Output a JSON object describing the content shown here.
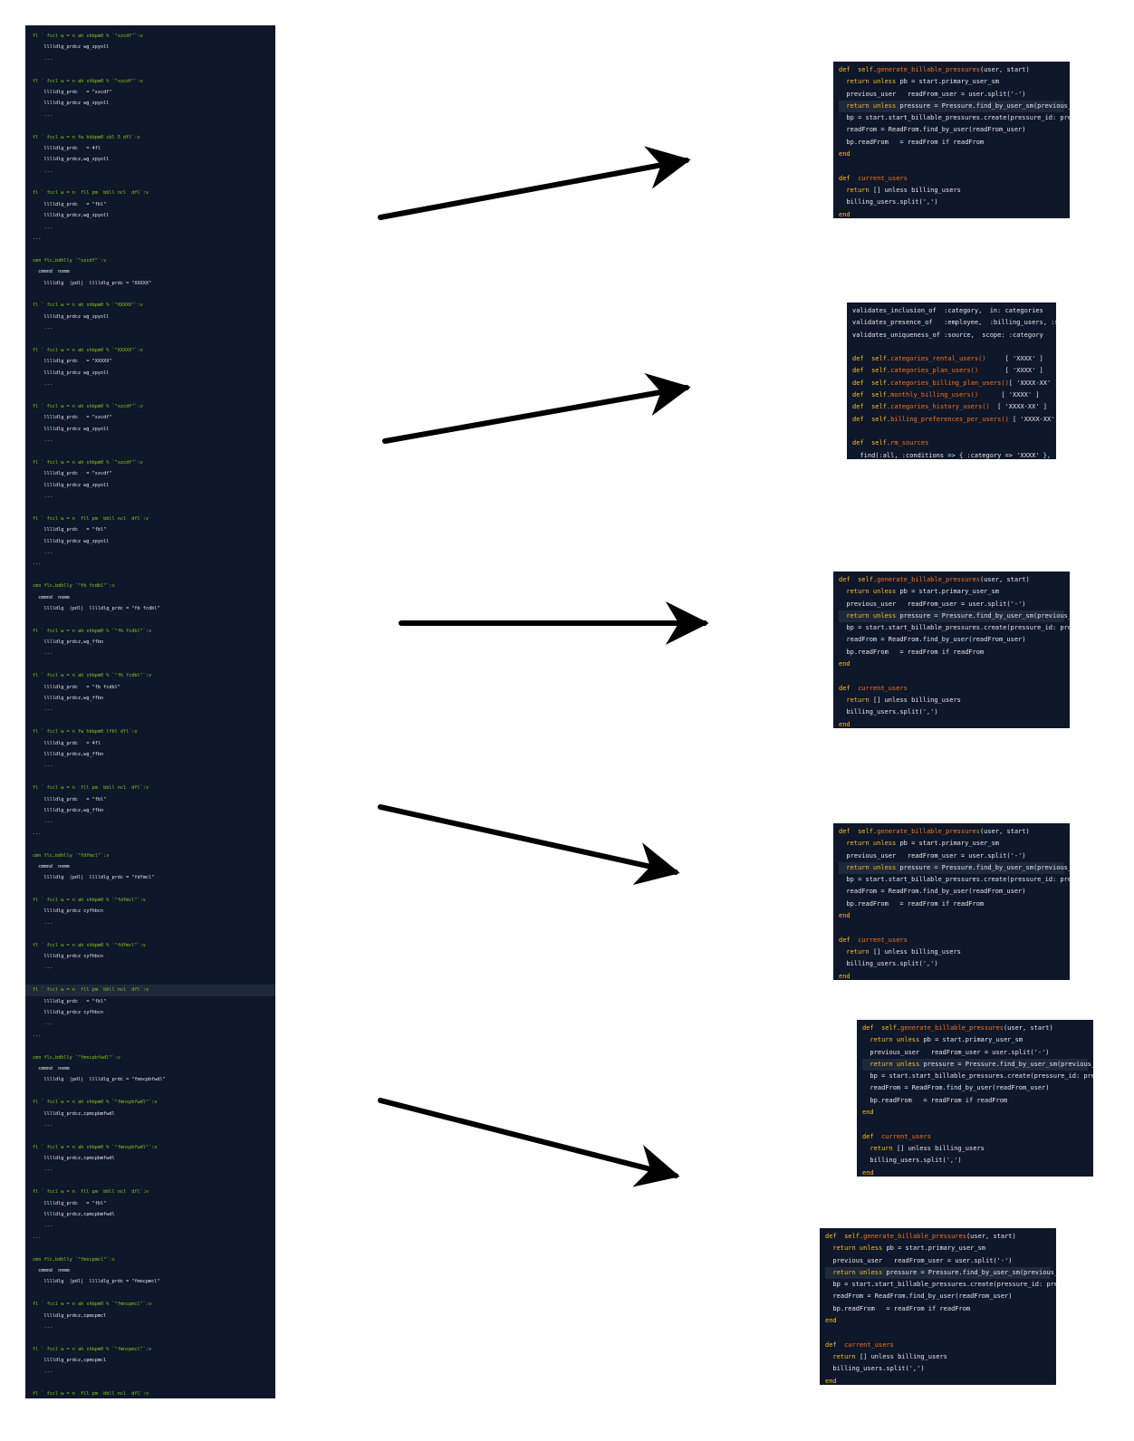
{
  "left_panel": {
    "lines": [
      {
        "t": "fl ` fccl w = n ah shbpm0 % `\"xzcdf\"`:v",
        "cls": "c-str"
      },
      {
        "t": "    lllldlg_prdcz wg_zpyoll",
        "cls": "c-def"
      },
      {
        "t": "    ...",
        "cls": "c-key"
      },
      {
        "t": "",
        "cls": "c-def"
      },
      {
        "t": "fl ` fccl w = n ah shbpm0 % `\"xzcdf\"`:v",
        "cls": "c-str"
      },
      {
        "t": "    lllldlg_prdc   = \"xzcdf\"",
        "cls": "c-def"
      },
      {
        "t": "    lllldlg_prdcz wg_zpyoll",
        "cls": "c-def"
      },
      {
        "t": "    ...",
        "cls": "c-key"
      },
      {
        "t": "",
        "cls": "c-def"
      },
      {
        "t": "fl ` fccl w = n fw hbbpm0 cbl 5 dfl`:v",
        "cls": "c-str"
      },
      {
        "t": "    lllldlg_prdc   = 4fl",
        "cls": "c-def"
      },
      {
        "t": "    lllldlg_prdcz,wg_zpyoll",
        "cls": "c-def"
      },
      {
        "t": "    ...",
        "cls": "c-key"
      },
      {
        "t": "",
        "cls": "c-def"
      },
      {
        "t": "fl ` fccl w = n  fll pm  bbll ncl  dfl`:v",
        "cls": "c-str"
      },
      {
        "t": "    lllldlg_prdc   = \"fbl\"",
        "cls": "c-def"
      },
      {
        "t": "    lllldlg_prdcz,wg_zpyoll",
        "cls": "c-def"
      },
      {
        "t": "    ...",
        "cls": "c-key"
      },
      {
        "t": "...",
        "cls": "c-key"
      },
      {
        "t": "",
        "cls": "c-def"
      },
      {
        "t": "cmn flc,bdhlly `\"xzcdf\"`:v",
        "cls": "c-str"
      },
      {
        "t": "  cmmnd  nnmm",
        "cls": "c-def"
      },
      {
        "t": "    lllldlg  |pdl|  lllldlg_prdc = \"XXXXX\"",
        "cls": "c-def"
      },
      {
        "t": "",
        "cls": "c-def"
      },
      {
        "t": "fl ` fccl w = n ah shbpm0 % `\"XXXXX\"`:v",
        "cls": "c-str"
      },
      {
        "t": "    lllldlg_prdcz wg_zpyoll",
        "cls": "c-def"
      },
      {
        "t": "    ...",
        "cls": "c-key"
      },
      {
        "t": "",
        "cls": "c-def"
      },
      {
        "t": "fl ` fccl w = n ah shbpm0 % `\"XXXXX\"`:v",
        "cls": "c-str"
      },
      {
        "t": "    lllldlg_prdc   = \"XXXXX\"",
        "cls": "c-def"
      },
      {
        "t": "    lllldlg_prdcz wg_zpyoll",
        "cls": "c-def"
      },
      {
        "t": "    ...",
        "cls": "c-key"
      },
      {
        "t": "",
        "cls": "c-def"
      },
      {
        "t": "fl ` fccl w = n ah shbpm0 % `\"xzcdf\"`:v",
        "cls": "c-str"
      },
      {
        "t": "    lllldlg_prdc   = \"xzcdf\"",
        "cls": "c-def"
      },
      {
        "t": "    lllldlg_prdcz wg_zpyoll",
        "cls": "c-def"
      },
      {
        "t": "    ...",
        "cls": "c-key"
      },
      {
        "t": "",
        "cls": "c-def"
      },
      {
        "t": "fl ` fccl w = n ah shbpm0 % `\"xzcdf\"`:v",
        "cls": "c-str"
      },
      {
        "t": "    lllldlg_prdc   = \"xzcdf\"",
        "cls": "c-def"
      },
      {
        "t": "    lllldlg_prdcz wg_zpyoll",
        "cls": "c-def"
      },
      {
        "t": "    ...",
        "cls": "c-key"
      },
      {
        "t": "",
        "cls": "c-def"
      },
      {
        "t": "fl ` fccl w = n  fll pm  bbll ncl  dfl`:v",
        "cls": "c-str"
      },
      {
        "t": "    lllldlg_prdc   = \"fbl\"",
        "cls": "c-def"
      },
      {
        "t": "    lllldlg_prdcz wg_zpyoll",
        "cls": "c-def"
      },
      {
        "t": "    ...",
        "cls": "c-key"
      },
      {
        "t": "...",
        "cls": "c-key"
      },
      {
        "t": "",
        "cls": "c-def"
      },
      {
        "t": "cmn flc,bdhlly `\"fb fcdbl\"`:v",
        "cls": "c-str"
      },
      {
        "t": "  cmmnd  nnmm",
        "cls": "c-def"
      },
      {
        "t": "    lllldlg  |pdl|  lllldlg_prdc = \"fb fcdbl\"",
        "cls": "c-def"
      },
      {
        "t": "",
        "cls": "c-def"
      },
      {
        "t": "fl ` fccl w = n ah shbpm0 % `\"fb fcdbl\"`:v",
        "cls": "c-str"
      },
      {
        "t": "    lllldlg_prdcz,wg_ffbn",
        "cls": "c-def"
      },
      {
        "t": "    ...",
        "cls": "c-key"
      },
      {
        "t": "",
        "cls": "c-def"
      },
      {
        "t": "fl ` fccl w = n ah shbpm0 % `\"fb fcdbl\"`:v",
        "cls": "c-str"
      },
      {
        "t": "    lllldlg_prdc   = \"fb fcdbl\"",
        "cls": "c-def"
      },
      {
        "t": "    lllldlg_prdcz,wg_ffbn",
        "cls": "c-def"
      },
      {
        "t": "    ...",
        "cls": "c-key"
      },
      {
        "t": "",
        "cls": "c-def"
      },
      {
        "t": "fl ` fccl w = n fw hbbpm0 lfbl dfl`:v",
        "cls": "c-str"
      },
      {
        "t": "    lllldlg_prdc   = 4fl",
        "cls": "c-def"
      },
      {
        "t": "    lllldlg_prdcz,wg_ffbn",
        "cls": "c-def"
      },
      {
        "t": "    ...",
        "cls": "c-key"
      },
      {
        "t": "",
        "cls": "c-def"
      },
      {
        "t": "fl ` fccl w = n  fll pm  bbll ncl  dfl`:v",
        "cls": "c-str"
      },
      {
        "t": "    lllldlg_prdc   = \"fbl\"",
        "cls": "c-def"
      },
      {
        "t": "    lllldlg_prdcz,wg_ffbn",
        "cls": "c-def"
      },
      {
        "t": "    ...",
        "cls": "c-key"
      },
      {
        "t": "...",
        "cls": "c-key"
      },
      {
        "t": "",
        "cls": "c-def"
      },
      {
        "t": "cmn flc,bdhlly `\"fdfmcl\"`:v",
        "cls": "c-str"
      },
      {
        "t": "  cmmnd  nnmm",
        "cls": "c-def"
      },
      {
        "t": "    lllldlg  |pdl|  lllldlg_prdc = \"fdfmcl\"",
        "cls": "c-def"
      },
      {
        "t": "",
        "cls": "c-def"
      },
      {
        "t": "fl ` fccl w = n ah shbpm0 % `\"fdfmcl\"`:v",
        "cls": "c-str"
      },
      {
        "t": "    lllldlg_prdcz cyfhbcn",
        "cls": "c-def"
      },
      {
        "t": "    ...",
        "cls": "c-key"
      },
      {
        "t": "",
        "cls": "c-def"
      },
      {
        "t": "fl ` fccl w = n ah shbpm0 % `\"fdfmcl\"`:v",
        "cls": "c-str"
      },
      {
        "t": "    lllldlg_prdcz cyfhbcn",
        "cls": "c-def"
      },
      {
        "t": "    ...",
        "cls": "c-key"
      },
      {
        "t": "",
        "cls": "c-def"
      },
      {
        "t": "fl ` fccl w = n  fll pm  bbll ncl  dfl`:v",
        "cls": "c-str",
        "hl": true
      },
      {
        "t": "    lllldlg_prdc   = \"fbl\"",
        "cls": "c-def"
      },
      {
        "t": "    lllldlg_prdcz cyfhbcn",
        "cls": "c-def"
      },
      {
        "t": "    ...",
        "cls": "c-key"
      },
      {
        "t": "...",
        "cls": "c-key"
      },
      {
        "t": "",
        "cls": "c-def"
      },
      {
        "t": "cmn flc,bdhlly `\"fmncpbfwdl\"`:v",
        "cls": "c-str"
      },
      {
        "t": "  cmmnd  nnmm",
        "cls": "c-def"
      },
      {
        "t": "    lllldlg  |pdl|  lllldlg_prdc = \"fmncpbfwdl\"",
        "cls": "c-def"
      },
      {
        "t": "",
        "cls": "c-def"
      },
      {
        "t": "fl ` fccl w = n ah shbpm0 % `\"fmncpbfwdl\"`:v",
        "cls": "c-str"
      },
      {
        "t": "    lllldlg_prdcz,cpmcpbmfwdl",
        "cls": "c-def"
      },
      {
        "t": "    ...",
        "cls": "c-key"
      },
      {
        "t": "",
        "cls": "c-def"
      },
      {
        "t": "fl ` fccl w = n ah shbpm0 % `\"fmncpbfwdl\"`:v",
        "cls": "c-str"
      },
      {
        "t": "    lllldlg_prdcz,cpmcpbmfwdl",
        "cls": "c-def"
      },
      {
        "t": "    ...",
        "cls": "c-key"
      },
      {
        "t": "",
        "cls": "c-def"
      },
      {
        "t": "fl ` fccl w = n  fll pm  bbll ncl  dfl`:v",
        "cls": "c-str"
      },
      {
        "t": "    lllldlg_prdc   = \"fbl\"",
        "cls": "c-def"
      },
      {
        "t": "    lllldlg_prdcz,cpmcpbmfwdl",
        "cls": "c-def"
      },
      {
        "t": "    ...",
        "cls": "c-key"
      },
      {
        "t": "...",
        "cls": "c-key"
      },
      {
        "t": "",
        "cls": "c-def"
      },
      {
        "t": "cmn flc,bdhlly `\"fmncpmcl\"`:v",
        "cls": "c-str"
      },
      {
        "t": "  cmmnd  nnmm",
        "cls": "c-def"
      },
      {
        "t": "    lllldlg  |pdl|  lllldlg_prdc = \"fmncpmcl\"",
        "cls": "c-def"
      },
      {
        "t": "",
        "cls": "c-def"
      },
      {
        "t": "fl ` fccl w = n ah shbpm0 % `\"fmncpmcl\"`:v",
        "cls": "c-str"
      },
      {
        "t": "    lllldlg_prdcz,cpmcpmcl",
        "cls": "c-def"
      },
      {
        "t": "    ...",
        "cls": "c-key"
      },
      {
        "t": "",
        "cls": "c-def"
      },
      {
        "t": "fl ` fccl w = n ah shbpm0 % `\"fmncpmcl\"`:v",
        "cls": "c-str"
      },
      {
        "t": "    lllldlg_prdcz,cpmcpmcl",
        "cls": "c-def"
      },
      {
        "t": "    ...",
        "cls": "c-key"
      },
      {
        "t": "",
        "cls": "c-def"
      },
      {
        "t": "fl ` fccl w = n  fll pm  bbll ncl  dfl`:v",
        "cls": "c-str"
      },
      {
        "t": "    lllldlg_prdc   = \"fbl\"",
        "cls": "c-def"
      },
      {
        "t": "    lllldlg_prdcz,cpmcpmcl",
        "cls": "c-def"
      },
      {
        "t": "    ...",
        "cls": "c-key"
      },
      {
        "t": "...",
        "cls": "c-key"
      }
    ]
  },
  "code_card_a": {
    "lines": [
      {
        "k": "def  self.",
        "f": "generate_billable_pressures",
        "r": "(user, start)",
        "hl": false
      },
      {
        "k": "  return unless ",
        "f": "",
        "r": "pb = start.primary_user_sm",
        "hl": false
      },
      {
        "k": "",
        "f": "",
        "r": "  previous_user   readFrom_user = user.split('-')",
        "hl": false
      },
      {
        "k": "  return unless ",
        "f": "",
        "r": "pressure = Pressure.find_by_user_sm(previous_user, pb.id)",
        "hl": true
      },
      {
        "k": "",
        "f": "",
        "r": "  bp = start.start_billable_pressures.create(pressure_id: pressure.id)",
        "hl": false
      },
      {
        "k": "",
        "f": "",
        "r": "  readFrom = ReadFrom.find_by_user(readFrom_user)",
        "hl": false
      },
      {
        "k": "",
        "f": "",
        "r": "  bp.readFrom   = readFrom if readFrom",
        "hl": false
      },
      {
        "k": "end",
        "f": "",
        "r": "",
        "hl": false
      },
      {
        "k": "",
        "f": "",
        "r": "",
        "hl": false
      },
      {
        "k": "def  ",
        "f": "current_users",
        "r": "",
        "hl": false
      },
      {
        "k": "  return ",
        "f": "",
        "r": "[] unless billing_users",
        "hl": false
      },
      {
        "k": "",
        "f": "",
        "r": "  billing_users.split(',')",
        "hl": false
      },
      {
        "k": "end",
        "f": "",
        "r": "",
        "hl": false
      }
    ]
  },
  "code_card_b": {
    "lines": [
      {
        "k": "",
        "f": "",
        "r": "validates_inclusion_of  :category,  in: categories",
        "hl": false
      },
      {
        "k": "",
        "f": "",
        "r": "validates_presence_of   :employee,  :billing_users, :source",
        "hl": false
      },
      {
        "k": "",
        "f": "",
        "r": "validates_uniqueness_of :source,  scope: :category",
        "hl": false
      },
      {
        "k": "",
        "f": "",
        "r": "",
        "hl": false
      },
      {
        "k": "def  self.",
        "f": "categories_rental_users()",
        "r": "     [ 'XXXX' ]          end",
        "hl": false
      },
      {
        "k": "def  self.",
        "f": "categories_plan_users()",
        "r": "       [ 'XXXX' ]          end",
        "hl": false
      },
      {
        "k": "def  self.",
        "f": "categories_billing_plan_users()",
        "r": "[ 'XXXX-XX' ]     end",
        "hl": false
      },
      {
        "k": "def  self.",
        "f": "monthly_billing_users()",
        "r": "      [ 'XXXX' ]          end",
        "hl": false
      },
      {
        "k": "def  self.",
        "f": "categories_history_users()",
        "r": "  [ 'XXXX-XX' ]     end",
        "hl": false
      },
      {
        "k": "def  self.",
        "f": "billing_preferences_per_users()",
        "r": " [ 'XXXX-XX', 'XXXX' ] end",
        "hl": false
      },
      {
        "k": "",
        "f": "",
        "r": "",
        "hl": false
      },
      {
        "k": "def  self.",
        "f": "rm_sources",
        "r": "",
        "hl": false
      },
      {
        "k": "",
        "f": "",
        "r": "  find(:all, :conditions => { :category => 'XXXX' }, :order => 'sources')",
        "hl": false
      },
      {
        "k": "end",
        "f": "",
        "r": "",
        "hl": false
      }
    ]
  }
}
